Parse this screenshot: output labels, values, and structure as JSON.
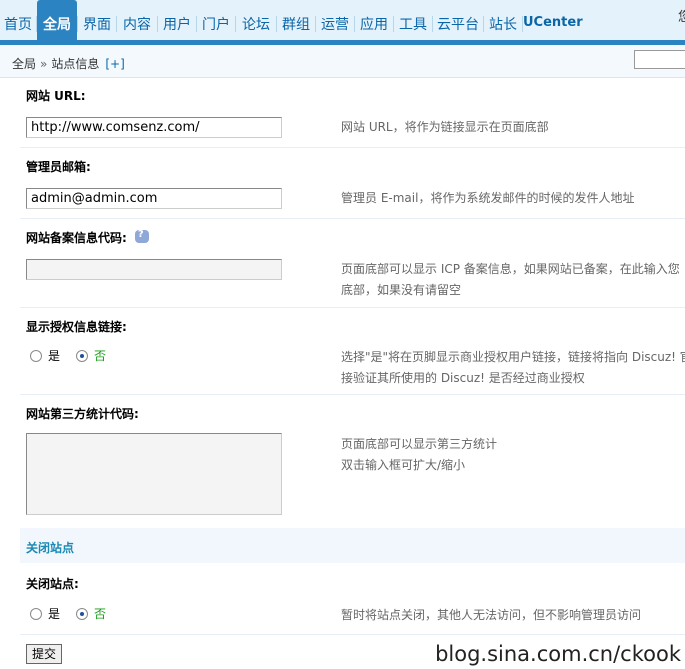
{
  "nav": {
    "tabs": [
      {
        "label": "首页",
        "active": false
      },
      {
        "label": "全局",
        "active": true
      },
      {
        "label": "界面",
        "active": false
      },
      {
        "label": "内容",
        "active": false
      },
      {
        "label": "用户",
        "active": false
      },
      {
        "label": "门户",
        "active": false
      },
      {
        "label": "论坛",
        "active": false
      },
      {
        "label": "群组",
        "active": false
      },
      {
        "label": "运营",
        "active": false
      },
      {
        "label": "应用",
        "active": false
      },
      {
        "label": "工具",
        "active": false
      },
      {
        "label": "云平台",
        "active": false
      },
      {
        "label": "站长",
        "active": false
      },
      {
        "label": "UCenter",
        "active": false
      }
    ],
    "right_text": "您"
  },
  "breadcrumb": {
    "root": "全局",
    "separator": "»",
    "current": "站点信息",
    "add": "[+]"
  },
  "form": {
    "site_url": {
      "label": "网站 URL:",
      "value": "http://www.comsenz.com/",
      "tip": "网站 URL，将作为链接显示在页面底部"
    },
    "admin_email": {
      "label": "管理员邮箱:",
      "value": "admin@admin.com",
      "tip": "管理员 E-mail，将作为系统发邮件的时候的发件人地址"
    },
    "icp": {
      "label": "网站备案信息代码:",
      "value": "",
      "tip_line1": "页面底部可以显示 ICP 备案信息，如果网站已备案，在此输入您",
      "tip_line2": "底部，如果没有请留空"
    },
    "license_link": {
      "label": "显示授权信息链接:",
      "option_yes": "是",
      "option_no": "否",
      "selected": "否",
      "tip_line1": "选择\"是\"将在页脚显示商业授权用户链接，链接将指向 Discuz! 官",
      "tip_line2": "接验证其所使用的 Discuz! 是否经过商业授权"
    },
    "stat_code": {
      "label": "网站第三方统计代码:",
      "value": "",
      "tip_line1": "页面底部可以显示第三方统计",
      "tip_line2": "双击输入框可扩大/缩小"
    },
    "close_section": {
      "title": "关闭站点"
    },
    "close_site": {
      "label": "关闭站点:",
      "option_yes": "是",
      "option_no": "否",
      "selected": "否",
      "tip": "暂时将站点关闭，其他人无法访问，但不影响管理员访问"
    },
    "submit_label": "提交"
  },
  "watermark": "blog.sina.com.cn/ckook",
  "colors": {
    "nav_bg": "#e4f2fb",
    "nav_accent": "#2b83c2",
    "nav_text": "#0b66a8",
    "section_title": "#1a89b4",
    "selected_option": "#1a9b1a",
    "tip_text": "#666666"
  }
}
